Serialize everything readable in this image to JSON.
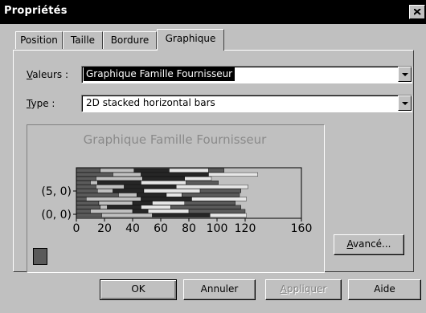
{
  "window": {
    "title": "Propriétés"
  },
  "tabs": [
    {
      "label": "Position"
    },
    {
      "label": "Taille"
    },
    {
      "label": "Bordure"
    },
    {
      "label": "Graphique",
      "active": true
    }
  ],
  "fields": {
    "valeurs": {
      "label_mnemonic": "V",
      "label_rest": "aleurs :",
      "value": "Graphique Famille Fournisseur"
    },
    "type": {
      "label_mnemonic": "T",
      "label_rest": "ype :",
      "value": "2D stacked horizontal bars"
    }
  },
  "chart_data": {
    "type": "bar",
    "orientation": "horizontal",
    "stacked": true,
    "title": "Graphique Famille Fournisseur",
    "x_ticks": [
      "0",
      "20",
      "40",
      "60",
      "80",
      "100",
      "120",
      "160"
    ],
    "y_ticks": [
      "(0, 0)",
      "(5, 0)"
    ],
    "xlim": [
      0,
      160
    ],
    "series_colors": [
      "#5a5a5a",
      "#c0c0c0",
      "#262626",
      "#e6e6e6"
    ],
    "rows": [
      [
        17,
        24,
        25,
        28,
        11
      ],
      [
        26,
        20,
        48,
        35
      ],
      [
        14,
        33,
        30,
        19
      ],
      [
        10,
        5,
        31,
        32,
        23
      ],
      [
        14,
        20,
        37,
        51
      ],
      [
        15,
        11,
        22,
        40,
        29
      ],
      [
        30,
        13,
        21,
        11,
        41
      ],
      [
        7,
        39,
        36,
        39
      ],
      [
        16,
        24,
        14,
        23,
        36
      ],
      [
        17,
        5,
        24,
        21,
        50
      ],
      [
        10,
        30,
        11,
        29,
        40
      ],
      [
        18,
        36,
        41,
        26
      ]
    ]
  },
  "buttons": {
    "avance": {
      "mnemonic": "A",
      "rest": "vancé..."
    },
    "ok": "OK",
    "annuler": "Annuler",
    "appliquer": {
      "mnemonic": "A",
      "rest": "ppliquer",
      "disabled": true
    },
    "aide": "Aide"
  }
}
